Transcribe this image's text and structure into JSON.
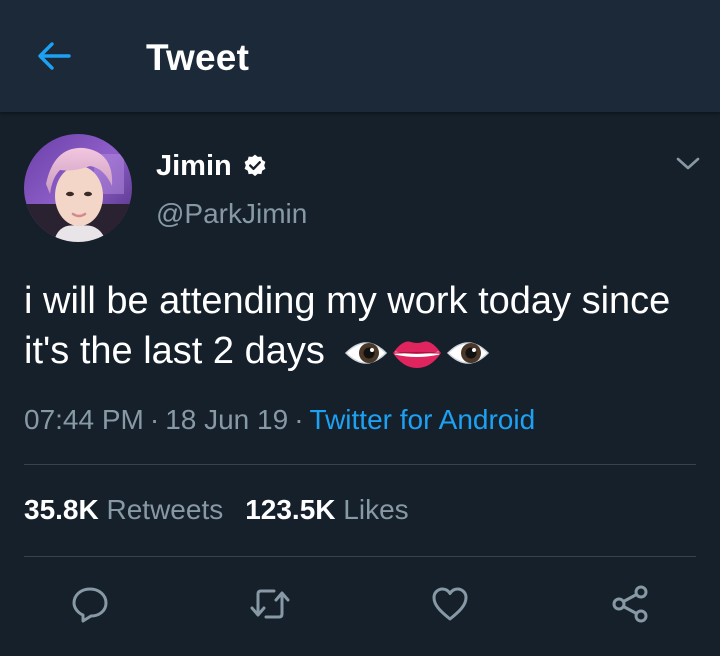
{
  "header": {
    "title": "Tweet",
    "back_icon": "arrow-left-icon"
  },
  "author": {
    "name": "Jimin",
    "handle": "@ParkJimin",
    "verified": true,
    "avatar_icon": "avatar-photo"
  },
  "tweet": {
    "text": "i will be attending my work today since it's the last 2 days",
    "emojis": [
      "eye",
      "lips",
      "eye"
    ],
    "time": "07:44 PM",
    "date": "18 Jun 19",
    "source": "Twitter for Android"
  },
  "stats": {
    "retweets_count": "35.8K",
    "retweets_label": "Retweets",
    "likes_count": "123.5K",
    "likes_label": "Likes"
  },
  "actions": [
    "reply-icon",
    "retweet-icon",
    "like-icon",
    "share-icon"
  ],
  "colors": {
    "background": "#15202b",
    "header": "#1c2938",
    "accent": "#1da1f2",
    "muted": "#8899a6",
    "divider": "#38444d"
  }
}
